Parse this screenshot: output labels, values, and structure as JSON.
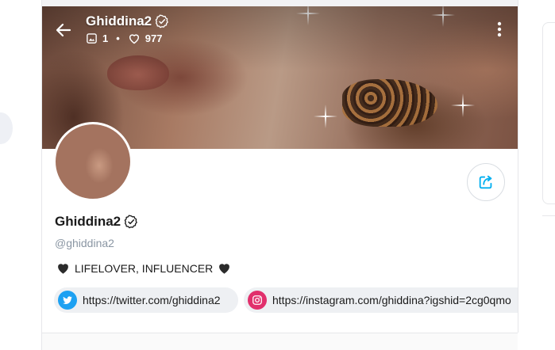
{
  "profile": {
    "name": "Ghiddina2",
    "handle": "@ghiddina2",
    "bio": "LIFELOVER, INFLUENCER",
    "stats": {
      "media_count": "1",
      "likes_count": "977"
    }
  },
  "links": [
    {
      "service": "twitter",
      "url": "https://twitter.com/ghiddina2"
    },
    {
      "service": "instagram",
      "url": "https://instagram.com/ghiddina?igshid=2cg0qmo"
    }
  ],
  "icons": {
    "back": "arrow-left-icon",
    "verified": "verified-badge-icon",
    "media": "image-icon",
    "likes": "heart-outline-icon",
    "more": "vertical-dots-icon",
    "share": "share-arrow-icon",
    "bio_heart": "black-heart-icon",
    "twitter": "twitter-bird-icon",
    "instagram": "instagram-camera-icon"
  },
  "colors": {
    "accent": "#00aff0",
    "twitter": "#1da1f2",
    "instagram": "#e1306c",
    "muted_text": "#8a96a3"
  }
}
